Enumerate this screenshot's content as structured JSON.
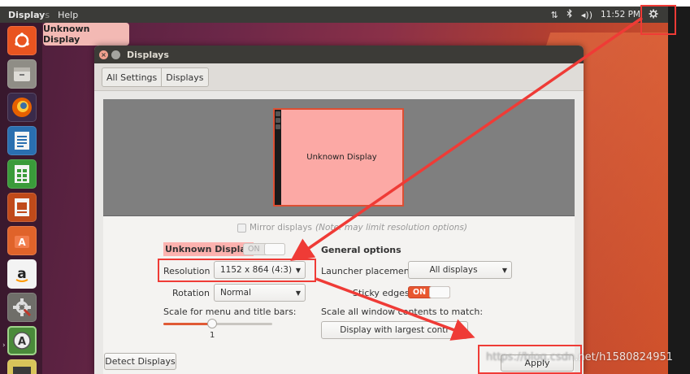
{
  "top_panel": {
    "app_name_visible": "Display",
    "app_name_faded": "s",
    "menu_help": "Help",
    "network_icon": "network-updown-icon",
    "bluetooth_icon": "bluetooth-icon",
    "volume_icon": "volume-icon",
    "clock": "11:52 PM",
    "settings_icon": "gear-icon"
  },
  "launcher": {
    "items": [
      {
        "name": "ubuntu-dash-icon",
        "color": "#e95420"
      },
      {
        "name": "files-icon",
        "color": "#8f8d86"
      },
      {
        "name": "firefox-icon",
        "color": "#e66000"
      },
      {
        "name": "libreoffice-writer-icon",
        "color": "#2a6fb0"
      },
      {
        "name": "libreoffice-calc-icon",
        "color": "#3a9b3a"
      },
      {
        "name": "libreoffice-impress-icon",
        "color": "#c04a1a"
      },
      {
        "name": "ubuntu-software-icon",
        "color": "#e0632a"
      },
      {
        "name": "amazon-icon",
        "color": "#f3f3f3"
      },
      {
        "name": "system-settings-icon",
        "color": "#6f6e69"
      },
      {
        "name": "software-updater-icon",
        "color": "#4a8a3a"
      },
      {
        "name": "terminal-icon",
        "color": "#d8c45a"
      }
    ]
  },
  "tooltip": {
    "text": "Unknown Display"
  },
  "window": {
    "title": "Displays",
    "breadcrumb": [
      "All Settings",
      "Displays"
    ],
    "monitor_label": "Unknown Display",
    "mirror_label": "Mirror displays",
    "mirror_note": "(Note: may limit resolution options)",
    "display_name": "Unknown Display",
    "display_switch": "ON",
    "resolution_label": "Resolution",
    "resolution_value": "1152 x 864 (4:3)",
    "rotation_label": "Rotation",
    "rotation_value": "Normal",
    "scale_label": "Scale for menu and title bars:",
    "scale_value": "1",
    "scale_fraction": 0.45,
    "general_options": "General options",
    "launcher_placement_label": "Launcher placement",
    "launcher_placement_value": "All displays",
    "sticky_edges_label": "Sticky edges",
    "sticky_edges_switch": "ON",
    "scale_all_label": "Scale all window contents to match:",
    "scale_all_value": "Display with largest contr",
    "detect_button": "Detect Displays",
    "apply_button": "Apply"
  },
  "watermark": {
    "prefix": "https://blog.csdn",
    "suffix": ".net/h1580824951"
  },
  "colors": {
    "accent_orange": "#e8572f",
    "annotation_red": "#ef3b36",
    "selection_pink": "#fcb2af"
  }
}
